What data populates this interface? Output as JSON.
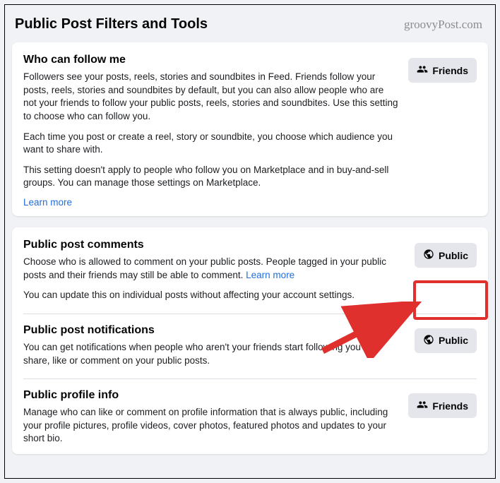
{
  "watermark": "groovyPost.com",
  "page_title": "Public Post Filters and Tools",
  "card1": {
    "title": "Who can follow me",
    "p1": "Followers see your posts, reels, stories and soundbites in Feed. Friends follow your posts, reels, stories and soundbites by default, but you can also allow people who are not your friends to follow your public posts, reels, stories and soundbites. Use this setting to choose who can follow you.",
    "p2": "Each time you post or create a reel, story or soundbite, you choose which audience you want to share with.",
    "p3": "This setting doesn't apply to people who follow you on Marketplace and in buy-and-sell groups. You can manage those settings on Marketplace.",
    "learn_more": "Learn more",
    "button_label": "Friends"
  },
  "card2": {
    "comments": {
      "title": "Public post comments",
      "p1_a": "Choose who is allowed to comment on your public posts. People tagged in your public posts and their friends may still be able to comment. ",
      "learn_more": "Learn more",
      "p2": "You can update this on individual posts without affecting your account settings.",
      "button_label": "Public"
    },
    "notifications": {
      "title": "Public post notifications",
      "p1": "You can get notifications when people who aren't your friends start following you and share, like or comment on your public posts.",
      "button_label": "Public"
    },
    "profile": {
      "title": "Public profile info",
      "p1": "Manage who can like or comment on profile information that is always public, including your profile pictures, profile videos, cover photos, featured photos and updates to your short bio.",
      "button_label": "Friends"
    }
  }
}
